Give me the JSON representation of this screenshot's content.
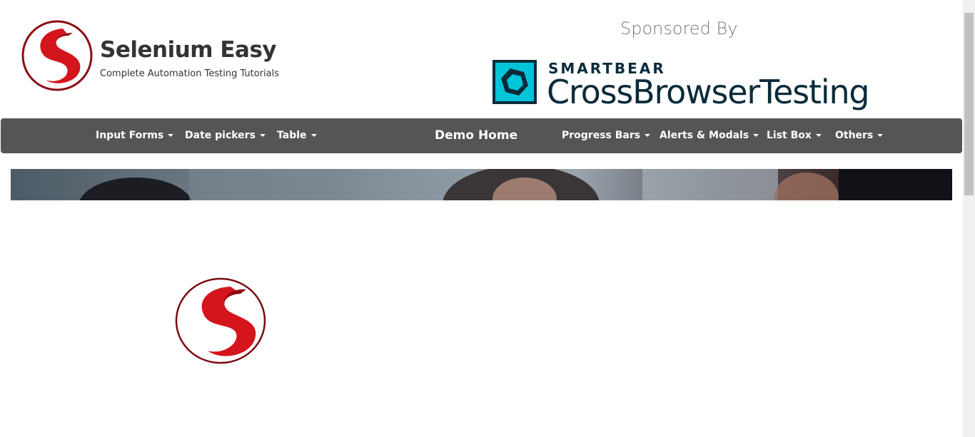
{
  "header": {
    "brand_title": "Selenium Easy",
    "brand_subtitle": "Complete Automation Testing Tutorials",
    "sponsored_label": "Sponsored By",
    "sponsor_top": "SMARTBEAR",
    "sponsor_main": "CrossBrowserTesting"
  },
  "nav": {
    "items": [
      {
        "label": "Input Forms"
      },
      {
        "label": "Date pickers"
      },
      {
        "label": "Table"
      },
      {
        "label": "Demo Home"
      },
      {
        "label": "Progress Bars"
      },
      {
        "label": "Alerts & Modals"
      },
      {
        "label": "List Box"
      },
      {
        "label": "Others"
      }
    ]
  },
  "colors": {
    "navbar": "#555555",
    "logo_red": "#c8161d",
    "sponsor_teal": "#00c4d8",
    "sponsor_text": "#0b2b3a"
  },
  "icons": [
    "selenium-easy-logo-icon",
    "smartbear-icon",
    "caret-down-icon"
  ]
}
